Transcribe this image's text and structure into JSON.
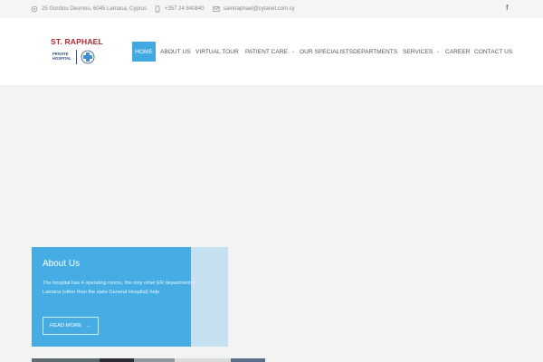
{
  "topbar": {
    "address": "25 Gordiou Desmou, 6045 Larnaca, Cyprus",
    "phone": "+357 24 840840",
    "email": "saintraphael@cytanet.com.cy",
    "social": "f"
  },
  "logo": {
    "title": "ST. RAPHAEL",
    "line1": "PRIVATE",
    "line2": "HOSPITAL"
  },
  "nav": {
    "items": [
      {
        "label": "HOME",
        "active": true
      },
      {
        "label": "ABOUT US"
      },
      {
        "label": "VIRTUAL TOUR"
      },
      {
        "label": "PATIENT CARE",
        "dropdown": true
      },
      {
        "label": "OUR SPECIALISTS"
      },
      {
        "label": "DEPARTMENTS"
      },
      {
        "label": "SERVICES",
        "dropdown": true
      },
      {
        "label": "CAREER"
      },
      {
        "label": "CONTACT US"
      }
    ]
  },
  "about": {
    "title": "About Us",
    "text": "The hospital has 4 operating rooms, the only other ER department in Larnaca (other than the state General Hospital) help",
    "button": "READ MORE",
    "arrow": "→"
  },
  "colors": {
    "accent": "#3fa9e0",
    "brand_red": "#b3272d",
    "brand_blue": "#2f4f88"
  },
  "icons": {
    "address": "location-pin-icon",
    "phone": "phone-icon",
    "email": "envelope-icon",
    "social": "facebook-icon",
    "chevron": "chevron-down-icon",
    "arrow": "arrow-right-icon"
  }
}
